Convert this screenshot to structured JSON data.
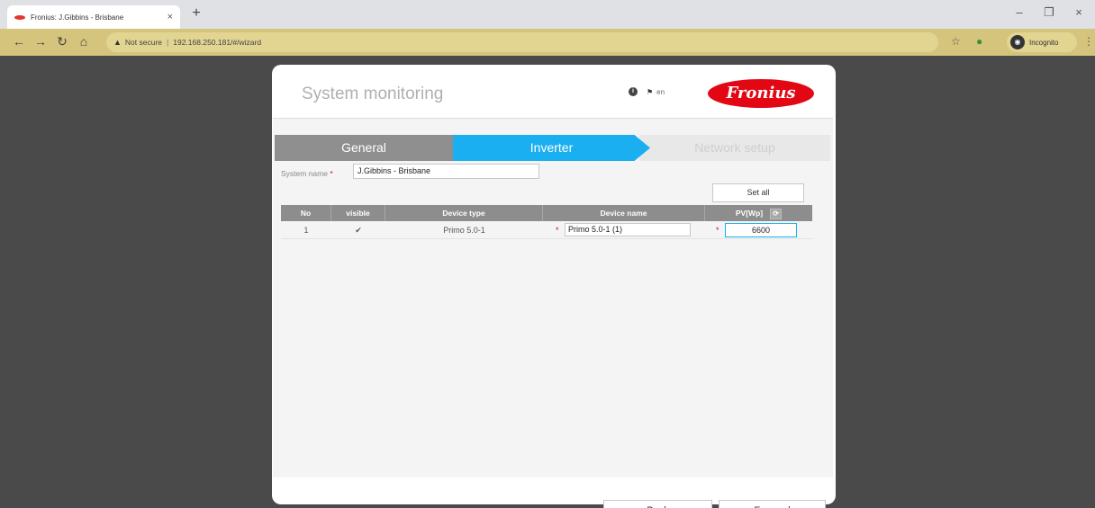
{
  "browser": {
    "tab_title": "Fronius: J.Gibbins - Brisbane",
    "tab_close": "×",
    "new_tab": "+",
    "security_label": "Not secure",
    "url": "192.168.250.181/#/wizard",
    "incognito_label": "Incognito",
    "minimize": "–",
    "maximize": "❐",
    "close": "×"
  },
  "header": {
    "title": "System monitoring",
    "language": "en",
    "brand": "Fronius"
  },
  "steps": {
    "general": "General",
    "inverter": "Inverter",
    "network": "Network setup"
  },
  "form": {
    "system_name_label": "System name",
    "required_mark": "*",
    "system_name_value": "J.Gibbins - Brisbane",
    "set_all_label": "Set all"
  },
  "table": {
    "columns": [
      "No",
      "visible",
      "Device type",
      "Device name",
      "PV[Wp]"
    ],
    "rows": [
      {
        "no": "1",
        "visible": true,
        "device_type": "Primo 5.0-1",
        "device_name": "Primo 5.0-1 (1)",
        "pv": "6600"
      }
    ]
  },
  "actions": {
    "back": "Back",
    "forward": "Forward"
  },
  "colors": {
    "active_step": "#1aaff0",
    "brand_red": "#e30613",
    "toolbar": "#d4c47c"
  }
}
